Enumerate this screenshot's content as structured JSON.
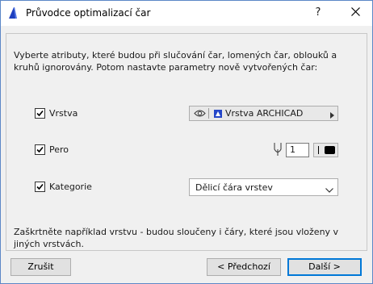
{
  "window": {
    "title": "Průvodce optimalizací čar",
    "help_label": "?"
  },
  "intro_text": "Vyberte atributy, které budou při slučování čar, lomených čar, oblouků a kruhů ignorovány. Potom nastavte parametry nově vytvořených čar:",
  "rows": {
    "layer": {
      "label": "Vrstva",
      "checked": true,
      "value": "Vrstva ARCHICAD"
    },
    "pen": {
      "label": "Pero",
      "checked": true,
      "value": "1"
    },
    "category": {
      "label": "Kategorie",
      "checked": true,
      "value": "Dělicí čára vrstev"
    }
  },
  "hint_text": "Zaškrtněte například vrstvu - budou sloučeny i čáry, které jsou vloženy v jiných vrstvách.",
  "buttons": {
    "cancel": "Zrušit",
    "back": "< Předchozí",
    "next": "Další >"
  },
  "colors": {
    "accent": "#0078d7",
    "window_border": "#5c87c7",
    "app_icon": "#1e3fbf"
  },
  "icons": {
    "app": "archicad-logo-icon",
    "close": "close-icon",
    "visibility": "eye-icon",
    "layer": "layer-icon",
    "pen": "pen-icon",
    "dropdown": "chevron-down-icon",
    "submenu": "triangle-right-icon"
  }
}
